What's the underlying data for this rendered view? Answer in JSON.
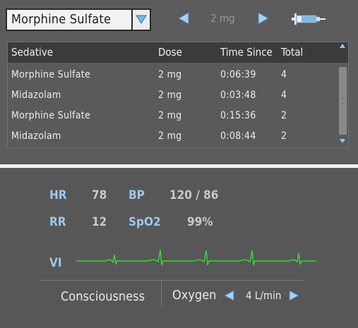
{
  "controls": {
    "sedative_select": "Morphine Sulfate",
    "dose_value": "2 mg"
  },
  "table": {
    "headers": [
      "Sedative",
      "Dose",
      "Time Since",
      "Total"
    ],
    "rows": [
      [
        "Morphine Sulfate",
        "2 mg",
        "0:06:39",
        "4"
      ],
      [
        "Midazolam",
        "2 mg",
        "0:03:48",
        "4"
      ],
      [
        "Morphine Sulfate",
        "2 mg",
        "0:15:36",
        "2"
      ],
      [
        "Midazolam",
        "2 mg",
        "0:08:44",
        "2"
      ]
    ]
  },
  "vitals": {
    "hr_label": "HR",
    "hr_value": "78",
    "bp_label": "BP",
    "bp_value": "120 / 86",
    "rr_label": "RR",
    "rr_value": "12",
    "spo2_label": "SpO2",
    "spo2_value": "99%",
    "vi_label": "VI"
  },
  "footer": {
    "consciousness": "Consciousness",
    "oxygen_label": "Oxygen",
    "oxygen_value": "4 L/min"
  },
  "colors": {
    "vital_label": "#9cc7ea",
    "ecg_trace": "#3ed63e",
    "arrow": "#a9d1f0"
  },
  "icons": {
    "dropdown": "triangle-down-icon",
    "prev": "triangle-left-icon",
    "next": "triangle-right-icon",
    "syringe": "syringe-icon"
  }
}
